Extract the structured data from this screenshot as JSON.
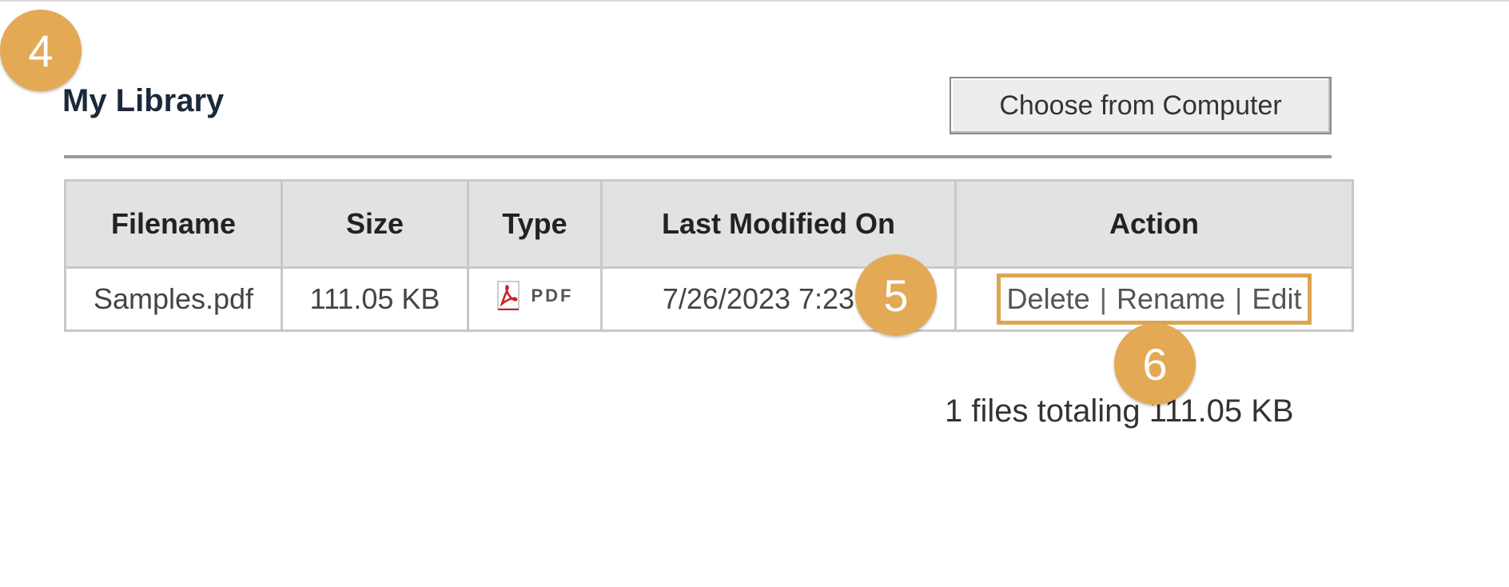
{
  "library": {
    "title": "My Library",
    "choose_button": "Choose from Computer",
    "columns": [
      "Filename",
      "Size",
      "Type",
      "Last Modified On",
      "Action"
    ],
    "rows": [
      {
        "filename": "Samples.pdf",
        "size": "111.05 KB",
        "type_label": "PDF",
        "type_icon": "pdf-icon",
        "last_modified": "7/26/2023 7:23:36",
        "actions": [
          "Delete",
          "Rename",
          "Edit"
        ]
      }
    ],
    "totals": "1 files totaling 111.05 KB"
  },
  "annotations": {
    "badge_4": "4",
    "badge_5": "5",
    "badge_6": "6"
  },
  "colors": {
    "badge": "#e3a955",
    "highlight_border": "#dca552",
    "header_bg": "#e2e2e2",
    "pdf_red": "#cc2222"
  }
}
